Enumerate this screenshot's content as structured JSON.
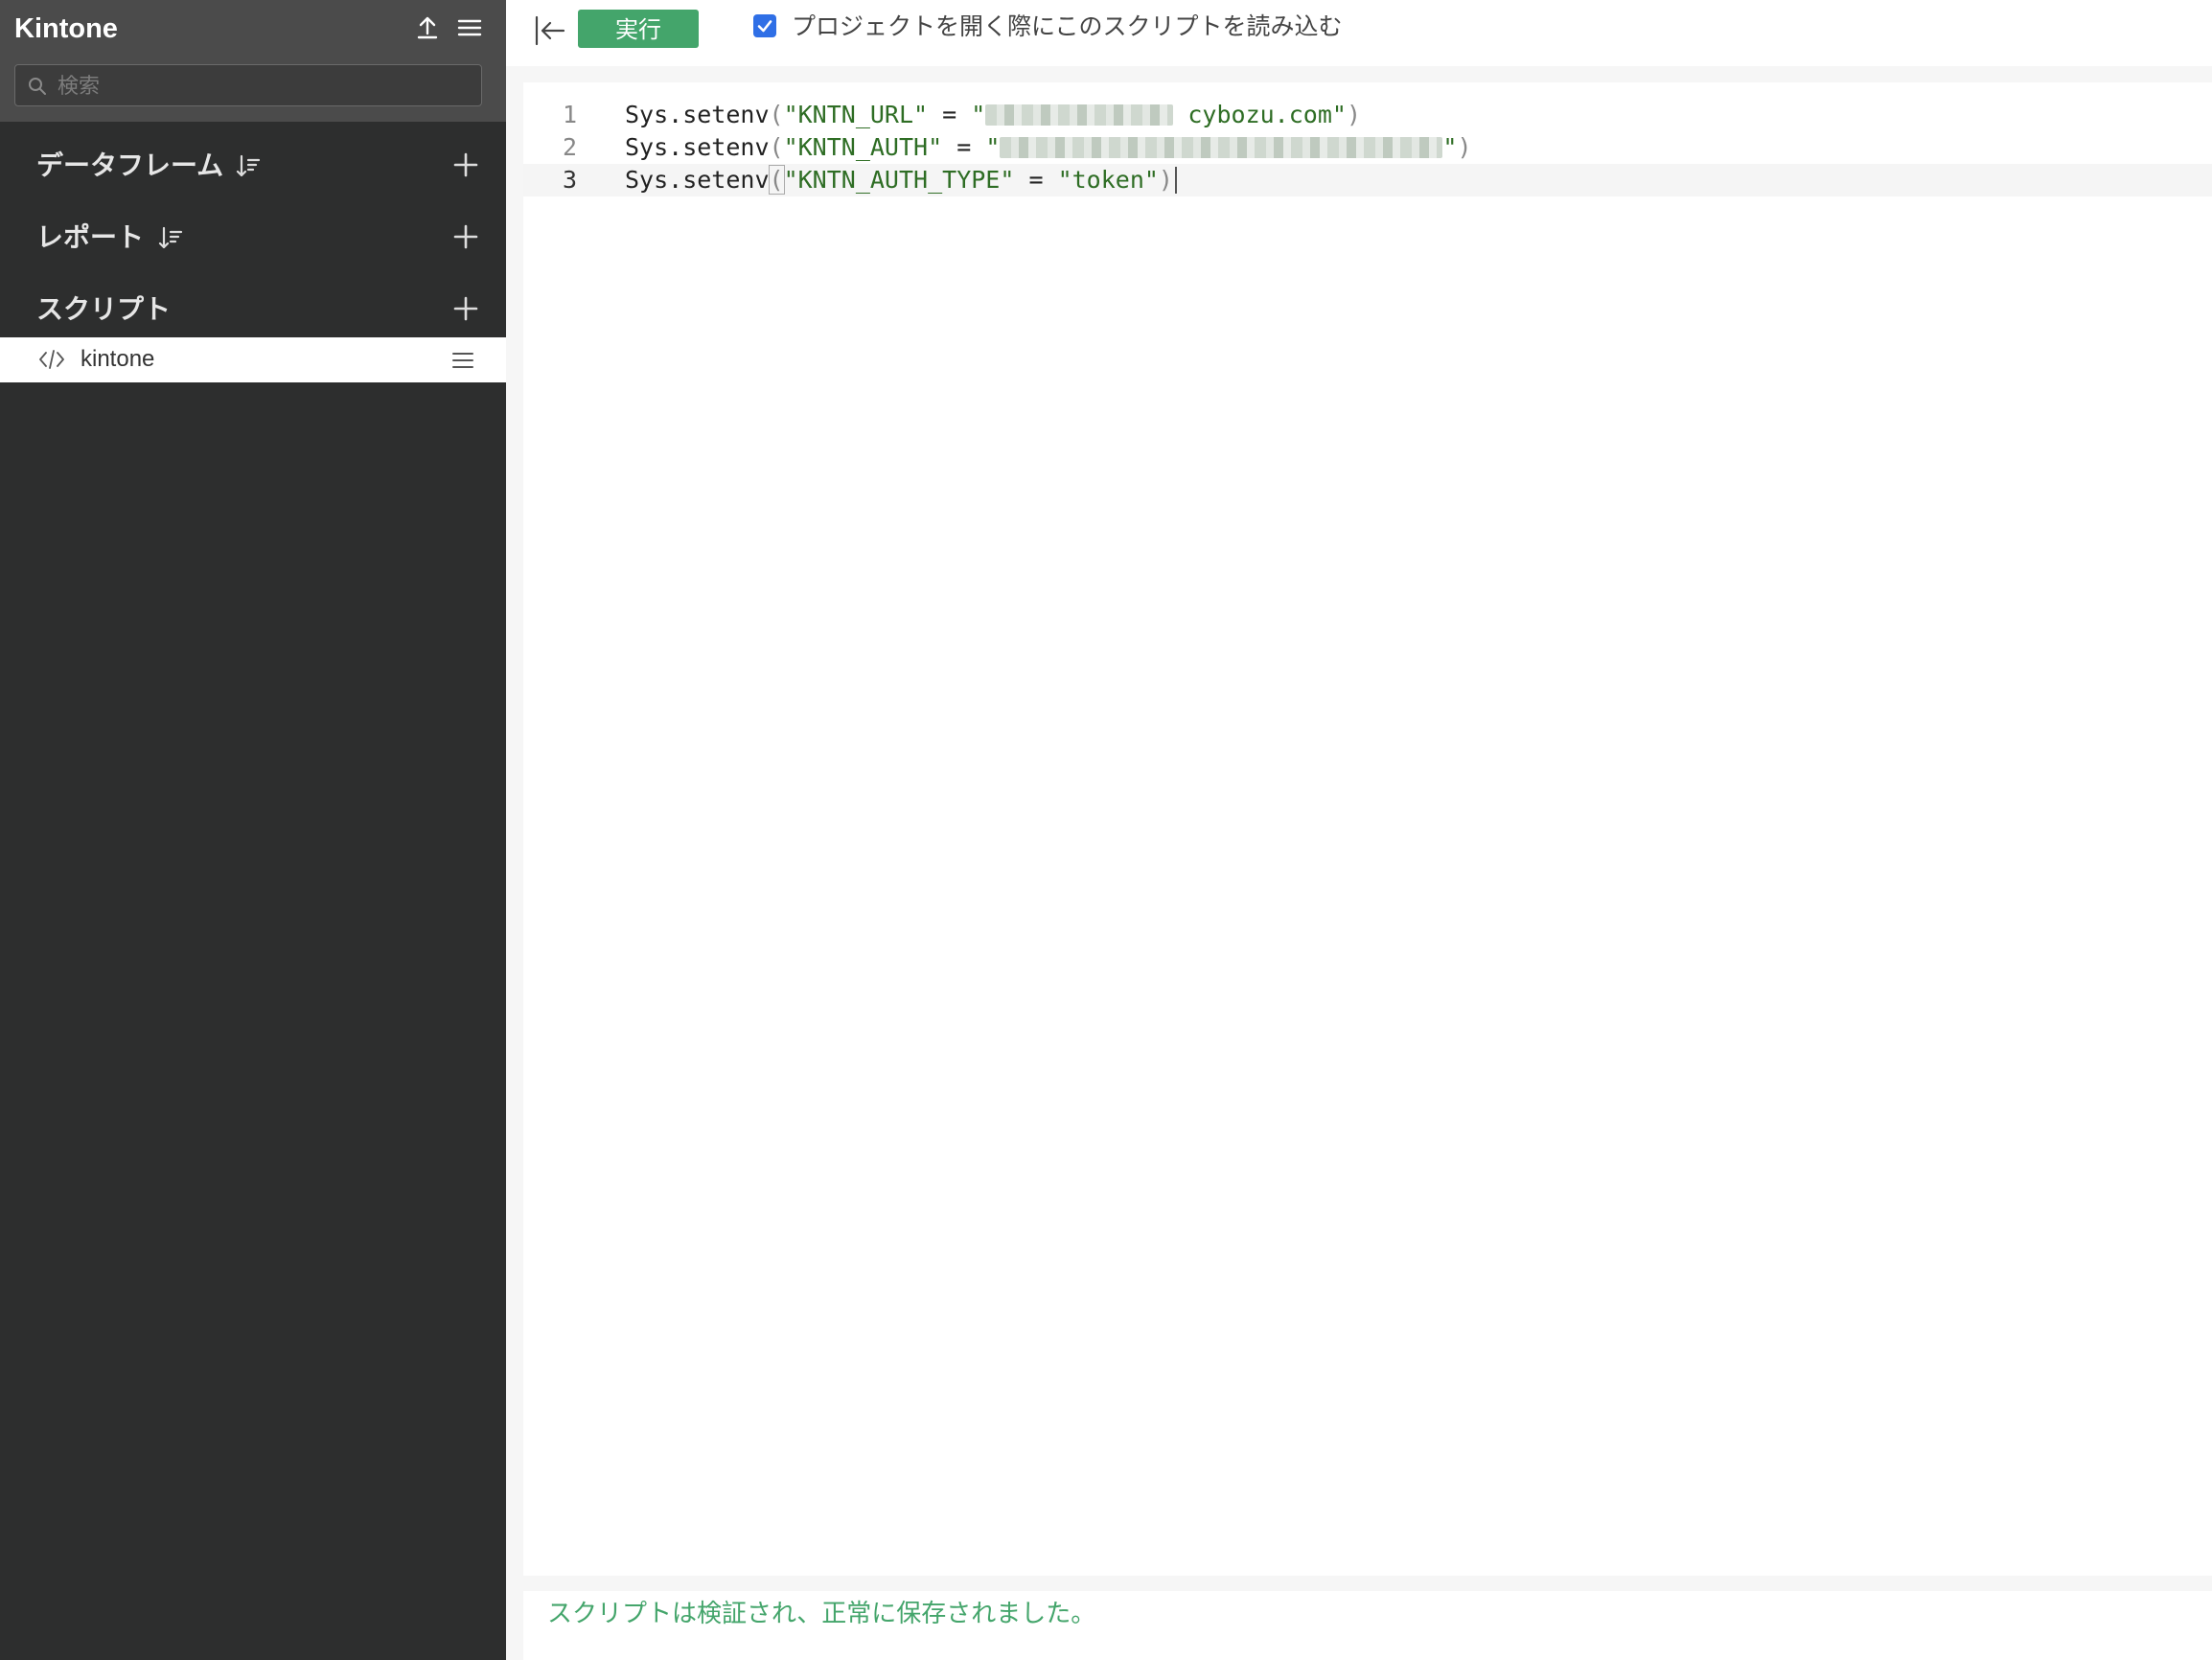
{
  "app": {
    "title": "Kintone"
  },
  "sidebar": {
    "search_placeholder": "検索",
    "sections": {
      "dataframes": "データフレーム",
      "reports": "レポート",
      "scripts": "スクリプト"
    },
    "script_items": [
      {
        "label": "kintone"
      }
    ]
  },
  "toolbar": {
    "run_label": "実行",
    "autoload_label": "プロジェクトを開く際にこのスクリプトを読み込む",
    "autoload_checked": true
  },
  "editor": {
    "line_numbers": [
      "1",
      "2",
      "3"
    ],
    "lines": [
      {
        "fn": "Sys.setenv",
        "key": "\"KNTN_URL\"",
        "op": " = ",
        "value_suffix": "cybozu.com\""
      },
      {
        "fn": "Sys.setenv",
        "key": "\"KNTN_AUTH\"",
        "op": " = ",
        "value_suffix": "\""
      },
      {
        "fn": "Sys.setenv",
        "key": "\"KNTN_AUTH_TYPE\"",
        "op": " = ",
        "value": "\"token\""
      }
    ]
  },
  "status": {
    "message": "スクリプトは検証され、正常に保存されました。"
  },
  "colors": {
    "accent": "#44a56b",
    "sidebar_bg": "#2d2e2e",
    "sidebar_header_bg": "#4b4b4b",
    "checkbox": "#2f6fe6"
  }
}
